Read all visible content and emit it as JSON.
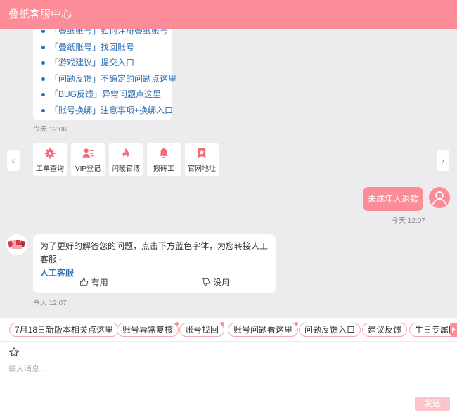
{
  "header": {
    "title": "叠纸客服中心"
  },
  "menu": {
    "items": [
      "「叠纸账号」如何注册叠纸账号",
      "「叠纸账号」找回账号",
      "「游戏建议」提交入口",
      "「问题反馈」不确定的问题点这里",
      "「BUG反馈」异常问题点这里",
      "「账号换绑」注意事项+换绑入口"
    ],
    "time": "今天 12:06"
  },
  "quick_actions": [
    {
      "label": "工单查询",
      "icon": "gear-icon"
    },
    {
      "label": "VIP登记",
      "icon": "vip-user-icon"
    },
    {
      "label": "闪暖官博",
      "icon": "flame-icon"
    },
    {
      "label": "搬砖工",
      "icon": "bell-icon"
    },
    {
      "label": "官网地址",
      "icon": "bookmark-star-icon"
    }
  ],
  "user_message": {
    "text": "未成年人退款",
    "time": "今天 12:07"
  },
  "bot_message": {
    "text": "为了更好的解答您的问题，点击下方蓝色字体，为您转接人工客服~",
    "link": "人工客服",
    "helpful": "有用",
    "unhelpful": "没用",
    "time": "今天 12:07"
  },
  "chips": [
    {
      "label": "7月18日新版本相关点这里",
      "dot": false
    },
    {
      "label": "账号异常复核",
      "dot": true
    },
    {
      "label": "账号找回",
      "dot": true
    },
    {
      "label": "账号问题看这里",
      "dot": true
    },
    {
      "label": "问题反馈入口",
      "dot": false
    },
    {
      "label": "建议反馈",
      "dot": false
    },
    {
      "label": "生日专属回",
      "dot": false
    }
  ],
  "input": {
    "placeholder": "输入消息...",
    "value": ""
  },
  "send_label": "发送",
  "colors": {
    "accent": "#fb8c98",
    "link": "#2f6fb5",
    "background": "#ededee"
  }
}
